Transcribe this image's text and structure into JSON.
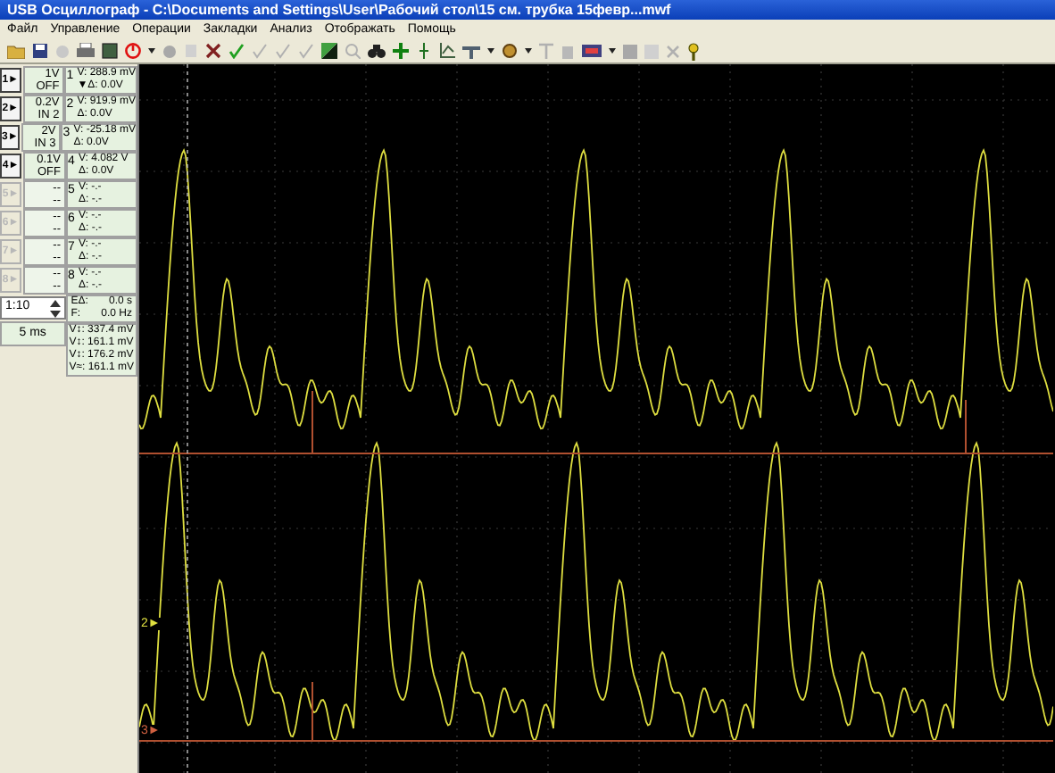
{
  "window": {
    "title": "USB Осциллограф - C:\\Documents and Settings\\User\\Рабочий стол\\15 см. трубка 15февр...mwf"
  },
  "menu": [
    "Файл",
    "Управление",
    "Операции",
    "Закладки",
    "Анализ",
    "Отображать",
    "Помощь"
  ],
  "channels": [
    {
      "button": "1►",
      "number": "1",
      "scale": "1V",
      "mode": "OFF",
      "enabled": true,
      "value": "V: 288.9 mV",
      "delta": "▼Δ: 0.0V"
    },
    {
      "button": "2►",
      "number": "2",
      "scale": "0.2V",
      "mode": "IN 2",
      "enabled": true,
      "value": "V: 919.9 mV",
      "delta": "Δ: 0.0V"
    },
    {
      "button": "3►",
      "number": "3",
      "scale": "2V",
      "mode": "IN 3",
      "enabled": true,
      "value": "V: -25.18 mV",
      "delta": "Δ: 0.0V"
    },
    {
      "button": "4►",
      "number": "4",
      "scale": "0.1V",
      "mode": "OFF",
      "enabled": true,
      "value": "V: 4.082 V",
      "delta": "Δ: 0.0V"
    },
    {
      "button": "5►",
      "number": "5",
      "scale": "--",
      "mode": "--",
      "enabled": false,
      "value": "V: -.-",
      "delta": "Δ: -.-"
    },
    {
      "button": "6►",
      "number": "6",
      "scale": "--",
      "mode": "--",
      "enabled": false,
      "value": "V: -.-",
      "delta": "Δ: -.-"
    },
    {
      "button": "7►",
      "number": "7",
      "scale": "--",
      "mode": "--",
      "enabled": false,
      "value": "V: -.-",
      "delta": "Δ: -.-"
    },
    {
      "button": "8►",
      "number": "8",
      "scale": "--",
      "mode": "--",
      "enabled": false,
      "value": "V: -.-",
      "delta": "Δ: -.-"
    }
  ],
  "ratio": "1:10",
  "timebase": "5 ms",
  "time_readings": [
    {
      "label": "EΔ:",
      "value": "0.0 s"
    },
    {
      "label": "F:",
      "value": "0.0 Hz"
    }
  ],
  "measurements": [
    "V↕: 337.4 mV",
    "V↕: 161.1 mV",
    "V↕: 176.2 mV",
    "V≈: 161.1 mV"
  ],
  "scope": {
    "markers": [
      {
        "label": "2►",
        "color": "#e0e040"
      },
      {
        "label": "3►",
        "color": "#d06040"
      }
    ]
  }
}
